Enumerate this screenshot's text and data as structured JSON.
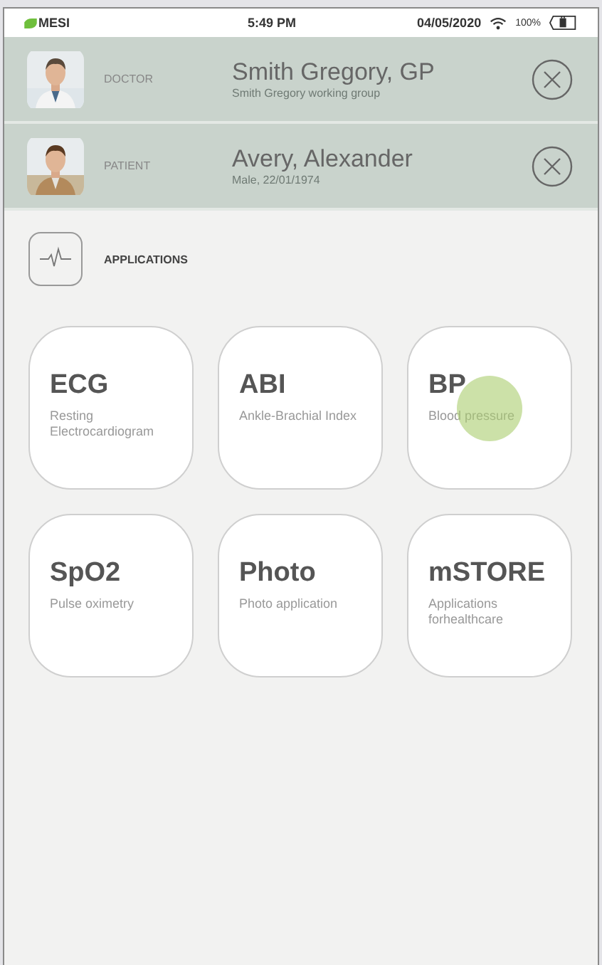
{
  "status_bar": {
    "brand": "MESI",
    "time": "5:49 PM",
    "date": "04/05/2020",
    "battery": "100%"
  },
  "people": [
    {
      "role": "DOCTOR",
      "name": "Smith Gregory, GP",
      "detail": "Smith Gregory working group"
    },
    {
      "role": "PATIENT",
      "name": "Avery, Alexander",
      "detail": "Male, 22/01/1974"
    }
  ],
  "section": {
    "title": "APPLICATIONS"
  },
  "apps": [
    {
      "title": "ECG",
      "subtitle": "Resting Electrocardiogram",
      "pressed": false
    },
    {
      "title": "ABI",
      "subtitle": "Ankle-Brachial Index",
      "pressed": false
    },
    {
      "title": "BP",
      "subtitle": "Blood pressure",
      "pressed": true
    },
    {
      "title": "SpO2",
      "subtitle": "Pulse oximetry",
      "pressed": false
    },
    {
      "title": "Photo",
      "subtitle": "Photo application",
      "pressed": false
    },
    {
      "title": "mSTORE",
      "subtitle": "Applications forhealthcare",
      "pressed": false
    }
  ]
}
